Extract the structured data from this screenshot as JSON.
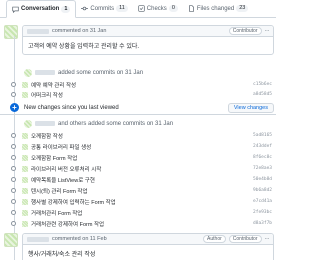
{
  "tabs": [
    {
      "label": "Conversation",
      "count": "1"
    },
    {
      "label": "Commits",
      "count": "11"
    },
    {
      "label": "Checks",
      "count": "0"
    },
    {
      "label": "Files changed",
      "count": "23"
    }
  ],
  "first_comment": {
    "date": "commented on 31 Jan",
    "badge": "Contributor",
    "body": "고객의 예약 상황을 입력하고 관리할 수 있다."
  },
  "event1": {
    "text": "added some commits on 31 Jan"
  },
  "commits1": [
    {
      "message": "예약 예약 관리 작성",
      "sha": "c15b6ec"
    },
    {
      "message": "어떠크리 작성",
      "sha": "a8d58d5"
    }
  ],
  "new_changes": {
    "label": "New changes since you last viewed",
    "button": "View changes"
  },
  "event2": {
    "text": "and others added some commits on 31 Jan"
  },
  "commits2": [
    {
      "message": "오께함함 작성",
      "sha": "5ad8165"
    },
    {
      "message": "공통 라이브러리 파일 생성",
      "sha": "243ddef"
    },
    {
      "message": "오께함함 Form 작업",
      "sha": "8f6ec8c"
    },
    {
      "message": "라이브러리 버전 오류처리 시작",
      "sha": "72e8ae3"
    },
    {
      "message": "예약목록을 ListView로 구현",
      "sha": "50e4b8d"
    },
    {
      "message": "텐시(퇴) 관리 Form 작업",
      "sha": "9b6a8d2"
    },
    {
      "message": "행사별 강제하여 입력하는 Form 작업",
      "sha": "e7cd41a"
    },
    {
      "message": "거래처관리 Form 작업",
      "sha": "2fe93bc"
    },
    {
      "message": "거래처관련 강제하여 Form 작업",
      "sha": "d8a3f7b"
    }
  ],
  "second_comment": {
    "date": "commented on 11 Feb",
    "badge_author": "Author",
    "badge": "Contributor",
    "body": "행사/거래처/숙소 관리 작성"
  }
}
